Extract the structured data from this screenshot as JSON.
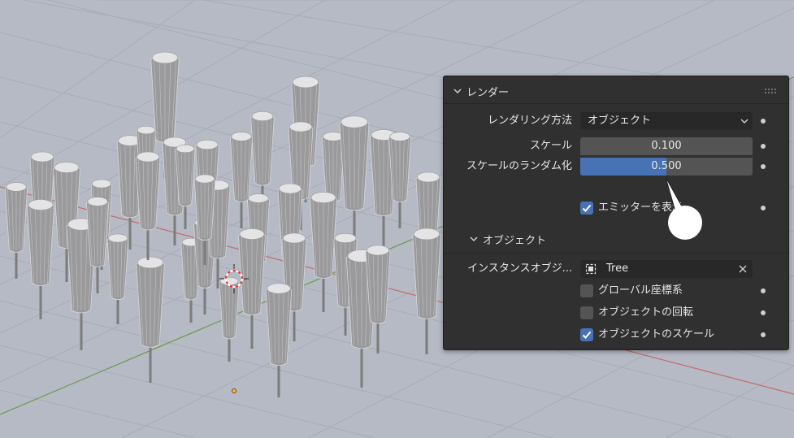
{
  "panel": {
    "render_header": "レンダー",
    "render_as": {
      "label": "レンダリング方法",
      "value": "オブジェクト"
    },
    "scale": {
      "label": "スケール",
      "value": "0.100"
    },
    "scale_random": {
      "label": "スケールのランダム化",
      "value": "0.500",
      "fill_fraction": 0.5
    },
    "show_emitter": {
      "label": "エミッターを表示",
      "checked": true
    },
    "object_header": "オブジェクト",
    "instance_object": {
      "label": "インスタンスオブジ...",
      "value": "Tree"
    },
    "global_coords": {
      "label": "グローバル座標系",
      "checked": false
    },
    "object_rotation": {
      "label": "オブジェクトの回転",
      "checked": false
    },
    "object_scale": {
      "label": "オブジェクトのスケール",
      "checked": true
    }
  },
  "colors": {
    "viewport_bg": "#b5bac5",
    "panel_bg": "#303030",
    "accent_blue": "#4772b3",
    "field_bg": "#545454"
  },
  "icons": [
    "chevron-down-icon",
    "drag-grip-icon",
    "dropdown-arrow-icon",
    "object-icon",
    "close-icon",
    "checkmark-icon",
    "animate-dot-icon",
    "mouse-cursor-icon"
  ]
}
